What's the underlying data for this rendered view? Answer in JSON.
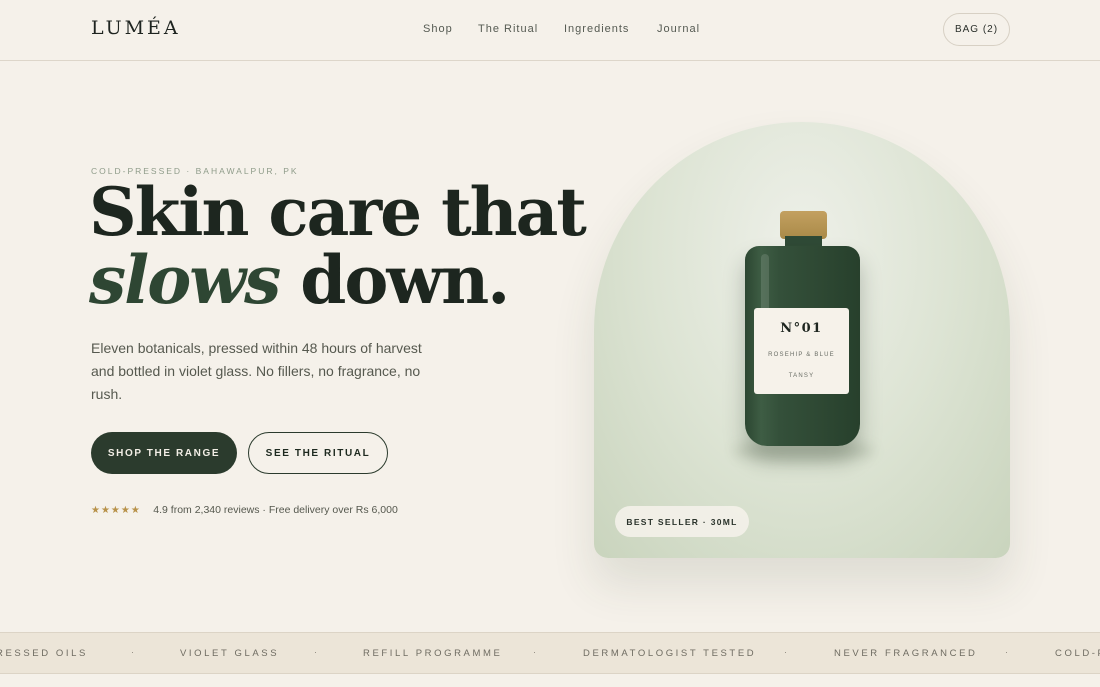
{
  "brand": {
    "logo": "LUMÉA"
  },
  "nav": {
    "links": [
      "Shop",
      "The Ritual",
      "Ingredients",
      "Journal"
    ],
    "bag_label": "BAG (2)"
  },
  "hero": {
    "eyebrow": "COLD-PRESSED · BAHAWALPUR, PK",
    "headline_line1": "Skin care that",
    "headline_italic": "slows",
    "headline_rest": "down.",
    "lede": "Eleven botanicals, pressed within 48 hours of harvest and bottled in violet glass. No fillers, no fragrance, no rush.",
    "primary_cta": "SHOP THE RANGE",
    "secondary_cta": "SEE THE RITUAL",
    "stars": "★★★★★",
    "rating_value": 4.9,
    "rating_text": "4.9 from 2,340 reviews · Free delivery over Rs 6,000"
  },
  "product": {
    "label_title": "N°01",
    "label_subtitle": "ROSEHIP & BLUE TANSY",
    "badge": "BEST SELLER · 30ML"
  },
  "strip": {
    "items": [
      "RESSED OILS",
      "VIOLET GLASS",
      "REFILL PROGRAMME",
      "DERMATOLOGIST TESTED",
      "NEVER FRAGRANCED",
      "COLD-P"
    ],
    "separator": "·"
  },
  "colors": {
    "background": "#f5f1ea",
    "primary_green": "#2b3b2d",
    "bottle_green": "#34503a",
    "cap_gold": "#b8924a",
    "card_sage": "#dde4d4",
    "strip_beige": "#ece5d8"
  }
}
